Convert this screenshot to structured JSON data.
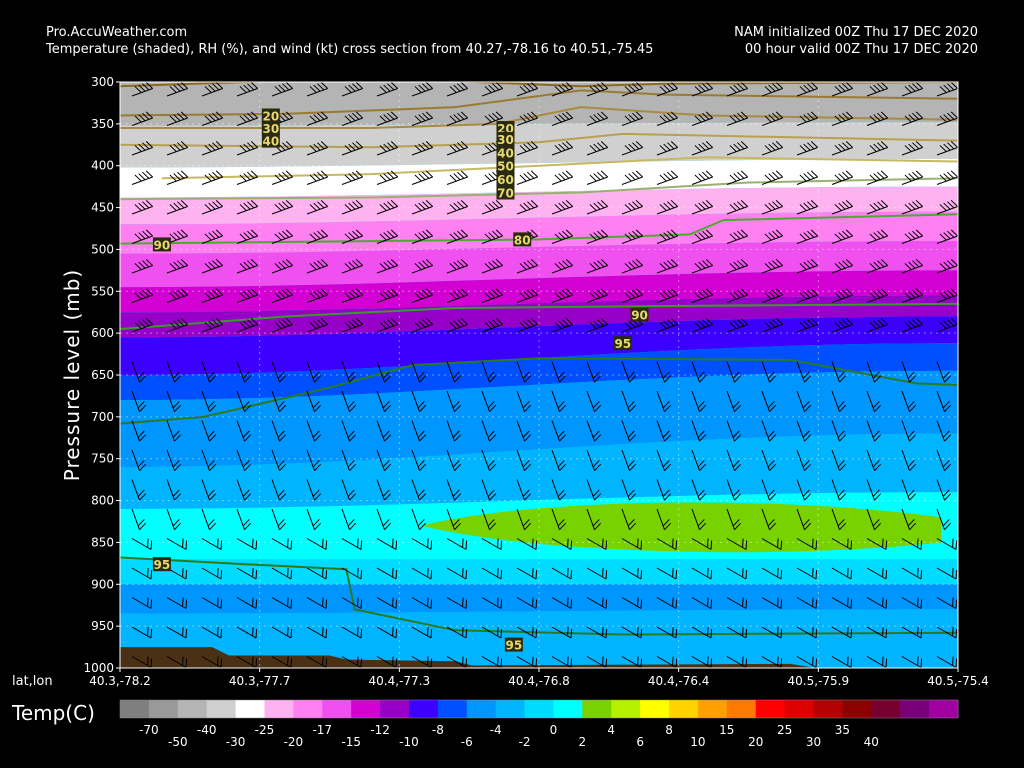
{
  "header": {
    "source": "Pro.AccuWeather.com",
    "description": "Temperature (shaded), RH (%), and wind (kt) cross section from 40.27,-78.16 to 40.51,-75.45",
    "init": "NAM initialized 00Z Thu 17 DEC 2020",
    "valid": "00 hour valid 00Z Thu 17 DEC 2020"
  },
  "chart_data": {
    "type": "heatmap",
    "ylabel": "Pressure level  (mb)",
    "xlabel": "lat,lon",
    "ylim": [
      1000,
      300
    ],
    "y_ticks": [
      "300",
      "350",
      "400",
      "450",
      "500",
      "550",
      "600",
      "650",
      "700",
      "750",
      "800",
      "850",
      "900",
      "950",
      "1000"
    ],
    "x_ticks": [
      "40.3,-78.2",
      "40.3,-77.7",
      "40.4,-77.3",
      "40.4,-76.8",
      "40.4,-76.4",
      "40.5,-75.9",
      "40.5,-75.4"
    ],
    "rh_contour_labels": [
      {
        "label": "20",
        "x_frac": 0.18,
        "p": 340
      },
      {
        "label": "30",
        "x_frac": 0.18,
        "p": 355
      },
      {
        "label": "40",
        "x_frac": 0.18,
        "p": 370
      },
      {
        "label": "20",
        "x_frac": 0.46,
        "p": 355
      },
      {
        "label": "30",
        "x_frac": 0.46,
        "p": 368
      },
      {
        "label": "40",
        "x_frac": 0.46,
        "p": 384
      },
      {
        "label": "50",
        "x_frac": 0.46,
        "p": 400
      },
      {
        "label": "60",
        "x_frac": 0.46,
        "p": 416
      },
      {
        "label": "70",
        "x_frac": 0.46,
        "p": 432
      },
      {
        "label": "90",
        "x_frac": 0.05,
        "p": 494
      },
      {
        "label": "80",
        "x_frac": 0.48,
        "p": 488
      },
      {
        "label": "90",
        "x_frac": 0.62,
        "p": 578
      },
      {
        "label": "95",
        "x_frac": 0.6,
        "p": 612
      },
      {
        "label": "95",
        "x_frac": 0.05,
        "p": 876
      },
      {
        "label": "95",
        "x_frac": 0.47,
        "p": 972
      }
    ],
    "legend": {
      "title": "Temp(C)",
      "colors": [
        "#7f7f7f",
        "#999999",
        "#b4b4b4",
        "#d0d0d0",
        "#ffffff",
        "#ffb2f0",
        "#ff80f0",
        "#f050f0",
        "#d200d2",
        "#9600c8",
        "#3c00ff",
        "#0050ff",
        "#0096ff",
        "#00b4ff",
        "#00dcff",
        "#00ffff",
        "#78d200",
        "#b4f000",
        "#ffff00",
        "#ffd200",
        "#ffa000",
        "#ff7800",
        "#ff0000",
        "#dc0000",
        "#b40000",
        "#8c0000",
        "#780030",
        "#780078",
        "#a000a0"
      ],
      "labels": [
        "-70",
        "-50",
        "-40",
        "-30",
        "-25",
        "-20",
        "-17",
        "-15",
        "-12",
        "-10",
        "-8",
        "-6",
        "-4",
        "-2",
        "0",
        "2",
        "4",
        "6",
        "8",
        "10",
        "15",
        "20",
        "25",
        "30",
        "35",
        "40"
      ]
    }
  }
}
